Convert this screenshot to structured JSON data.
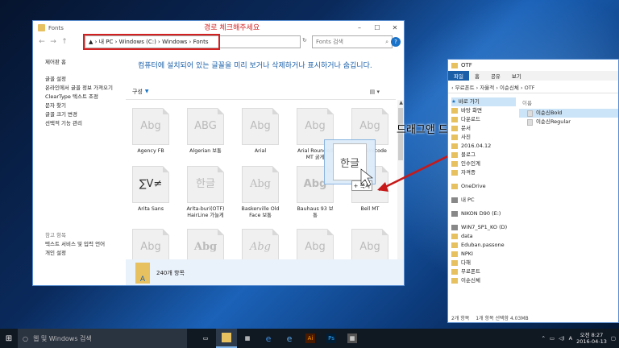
{
  "fonts_window": {
    "title": "Fonts",
    "annotation": "경로 체크해주세요",
    "address": "▲ › 내 PC › Windows (C:) › Windows › Fonts",
    "search_placeholder": "Fonts 검색",
    "heading": "컴퓨터에 설치되어 있는 글꼴을 미리 보거나 삭제하거나 표시하거나 숨깁니다.",
    "organize": "구성",
    "sidebar": {
      "home": "제어판 홈",
      "items": [
        "글꼴 설정",
        "온라인에서 글꼴 정보 가져오기",
        "ClearType 텍스트 조정",
        "문자 찾기",
        "글꼴 크기 변경",
        "선택적 기능 관리"
      ],
      "see_also": "참고 항목",
      "see_items": [
        "텍스트 서비스 및 입력 언어",
        "개인 설정"
      ]
    },
    "fonts": [
      {
        "name": "Agency FB",
        "preview": "Abg"
      },
      {
        "name": "Algerian 보통",
        "preview": "ABG"
      },
      {
        "name": "Arial",
        "preview": "Abg"
      },
      {
        "name": "Arial Rounded MT 굵게",
        "preview": "Abg"
      },
      {
        "name": "Arial Unicode",
        "preview": "Abg"
      },
      {
        "name": "Arita Sans",
        "preview": "∑V≠"
      },
      {
        "name": "Arita-buri(OTF) HairLine 가늘게",
        "preview": "한글"
      },
      {
        "name": "Baskerville Old Face 보통",
        "preview": "Abg"
      },
      {
        "name": "Bauhaus 93 보통",
        "preview": "Abg"
      },
      {
        "name": "Bell MT",
        "preview": ""
      },
      {
        "name": "",
        "preview": "Abg"
      },
      {
        "name": "",
        "preview": "Abg"
      },
      {
        "name": "",
        "preview": "Abg"
      },
      {
        "name": "",
        "preview": "Abg"
      },
      {
        "name": "",
        "preview": "Abg"
      }
    ],
    "status": "240개 항목"
  },
  "drag": {
    "ghost_text": "한글",
    "badge": "+ 복사",
    "label": "드래그앤 드롭"
  },
  "explorer": {
    "title": "OTF",
    "ribbon": [
      "파일",
      "홈",
      "공유",
      "보기"
    ],
    "address": "‹ 무료폰트 › 자율적 › 이순신체 › OTF",
    "nav": [
      {
        "label": "바로 가기",
        "type": "star",
        "sel": true
      },
      {
        "label": "바탕 화면",
        "type": "f"
      },
      {
        "label": "다운로드",
        "type": "f"
      },
      {
        "label": "문서",
        "type": "f"
      },
      {
        "label": "사진",
        "type": "f"
      },
      {
        "label": "2016.04.12",
        "type": "f"
      },
      {
        "label": "블로그",
        "type": "f"
      },
      {
        "label": "인수인계",
        "type": "f"
      },
      {
        "label": "자격증",
        "type": "f"
      },
      {
        "label": "",
        "type": "sp"
      },
      {
        "label": "OneDrive",
        "type": "f"
      },
      {
        "label": "",
        "type": "sp"
      },
      {
        "label": "내 PC",
        "type": "d"
      },
      {
        "label": "",
        "type": "sp"
      },
      {
        "label": "NIKON D90 (E:)",
        "type": "d"
      },
      {
        "label": "",
        "type": "sp"
      },
      {
        "label": "WIN7_SP1_KO (D)",
        "type": "d"
      },
      {
        "label": "data",
        "type": "f"
      },
      {
        "label": "Eduban.passone",
        "type": "f"
      },
      {
        "label": "NPKI",
        "type": "f"
      },
      {
        "label": "다해",
        "type": "f"
      },
      {
        "label": "무료폰트",
        "type": "f"
      },
      {
        "label": "이순신체",
        "type": "f"
      }
    ],
    "column": "이름",
    "files": [
      {
        "name": "이순신Bold",
        "sel": true
      },
      {
        "name": "이순신Regular",
        "sel": false
      }
    ],
    "status": [
      "2개 항목",
      "1개 항목 선택함 4.03MB"
    ]
  },
  "taskbar": {
    "search": "웹 및 Windows 검색",
    "time": "오전 8:27",
    "date": "2016-04-13",
    "lang": "A"
  }
}
